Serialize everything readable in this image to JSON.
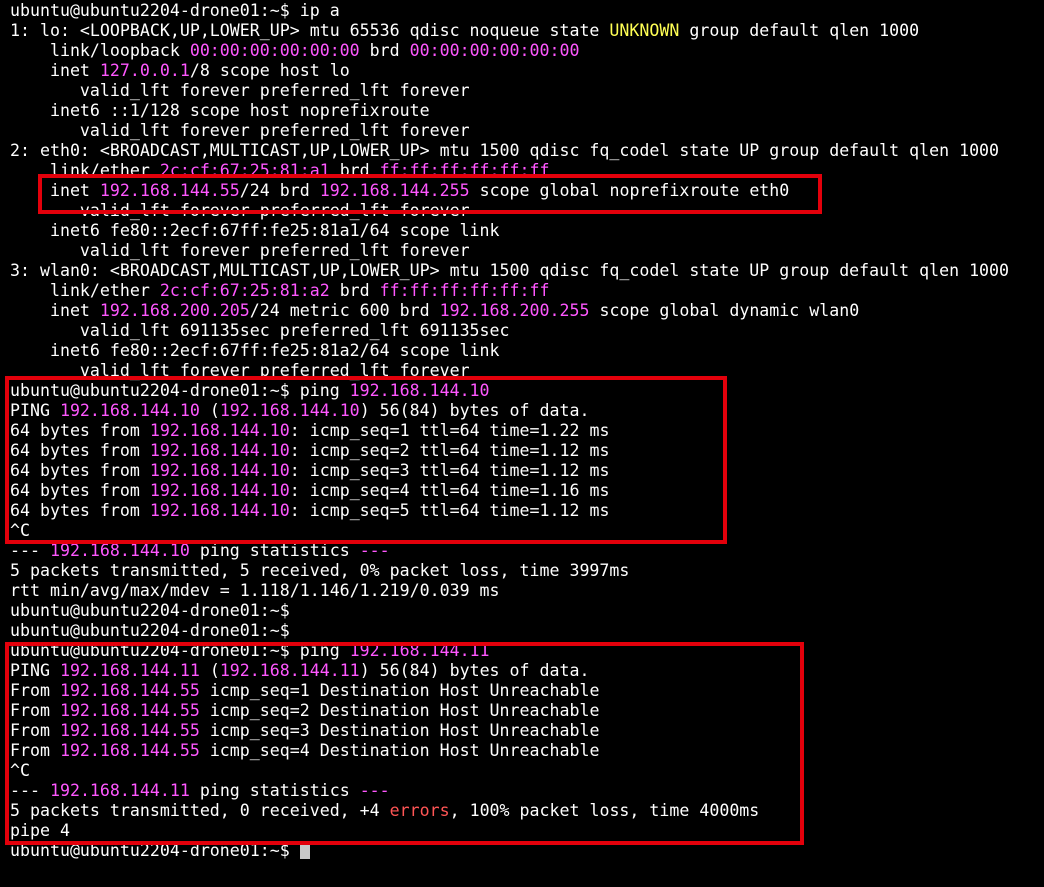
{
  "terminal": {
    "prompt": "ubuntu@ubuntu2204-drone01:~$",
    "lines": [
      [
        {
          "t": "ubuntu@ubuntu2204-drone01:~$ ip a",
          "c": "d"
        }
      ],
      [
        {
          "t": "1: lo: <LOOPBACK,UP,LOWER_UP> mtu 65536 qdisc noqueue state ",
          "c": "d"
        },
        {
          "t": "UNKNOWN",
          "c": "y"
        },
        {
          "t": " group default qlen 1000",
          "c": "d"
        }
      ],
      [
        {
          "t": "    link/loopback ",
          "c": "d"
        },
        {
          "t": "00:00:00:00:00:00",
          "c": "p"
        },
        {
          "t": " brd ",
          "c": "d"
        },
        {
          "t": "00:00:00:00:00:00",
          "c": "p"
        }
      ],
      [
        {
          "t": "    inet ",
          "c": "d"
        },
        {
          "t": "127.0.0.1",
          "c": "p"
        },
        {
          "t": "/8 scope host lo",
          "c": "d"
        }
      ],
      [
        {
          "t": "       valid_lft forever preferred_lft forever",
          "c": "d"
        }
      ],
      [
        {
          "t": "    inet6 ::1/128 scope host noprefixroute",
          "c": "d"
        }
      ],
      [
        {
          "t": "       valid_lft forever preferred_lft forever",
          "c": "d"
        }
      ],
      [
        {
          "t": "2: eth0: <BROADCAST,MULTICAST,UP,LOWER_UP> mtu 1500 qdisc fq_codel state UP group default qlen 1000",
          "c": "d"
        }
      ],
      [
        {
          "t": "    link/ether ",
          "c": "d"
        },
        {
          "t": "2c:cf:67:25:81:a1",
          "c": "p"
        },
        {
          "t": " brd ",
          "c": "d"
        },
        {
          "t": "ff:ff:ff:ff:ff:ff",
          "c": "p"
        }
      ],
      [
        {
          "t": "    inet ",
          "c": "d"
        },
        {
          "t": "192.168.144.55",
          "c": "p"
        },
        {
          "t": "/24 brd ",
          "c": "d"
        },
        {
          "t": "192.168.144.255",
          "c": "p"
        },
        {
          "t": " scope global noprefixroute eth0",
          "c": "d"
        }
      ],
      [
        {
          "t": "       valid_lft forever preferred_lft forever",
          "c": "d"
        }
      ],
      [
        {
          "t": "    inet6 fe80::2ecf:67ff:fe25:81a1/64 scope link",
          "c": "d"
        }
      ],
      [
        {
          "t": "       valid_lft forever preferred_lft forever",
          "c": "d"
        }
      ],
      [
        {
          "t": "3: wlan0: <BROADCAST,MULTICAST,UP,LOWER_UP> mtu 1500 qdisc fq_codel state UP group default qlen 1000",
          "c": "d"
        }
      ],
      [
        {
          "t": "    link/ether ",
          "c": "d"
        },
        {
          "t": "2c:cf:67:25:81:a2",
          "c": "p"
        },
        {
          "t": " brd ",
          "c": "d"
        },
        {
          "t": "ff:ff:ff:ff:ff:ff",
          "c": "p"
        }
      ],
      [
        {
          "t": "    inet ",
          "c": "d"
        },
        {
          "t": "192.168.200.205",
          "c": "p"
        },
        {
          "t": "/24 metric 600 brd ",
          "c": "d"
        },
        {
          "t": "192.168.200.255",
          "c": "p"
        },
        {
          "t": " scope global dynamic wlan0",
          "c": "d"
        }
      ],
      [
        {
          "t": "       valid_lft 691135sec preferred_lft 691135sec",
          "c": "d"
        }
      ],
      [
        {
          "t": "    inet6 fe80::2ecf:67ff:fe25:81a2/64 scope link",
          "c": "d"
        }
      ],
      [
        {
          "t": "       valid_lft forever preferred_lft forever",
          "c": "d"
        }
      ],
      [
        {
          "t": "ubuntu@ubuntu2204-drone01:~$ ping ",
          "c": "d"
        },
        {
          "t": "192.168.144.10",
          "c": "p"
        }
      ],
      [
        {
          "t": "PING ",
          "c": "d"
        },
        {
          "t": "192.168.144.10",
          "c": "p"
        },
        {
          "t": " (",
          "c": "d"
        },
        {
          "t": "192.168.144.10",
          "c": "p"
        },
        {
          "t": ") 56(84) bytes of data.",
          "c": "d"
        }
      ],
      [
        {
          "t": "64 bytes from ",
          "c": "d"
        },
        {
          "t": "192.168.144.10",
          "c": "p"
        },
        {
          "t": ": icmp_seq=1 ttl=64 time=1.22 ms",
          "c": "d"
        }
      ],
      [
        {
          "t": "64 bytes from ",
          "c": "d"
        },
        {
          "t": "192.168.144.10",
          "c": "p"
        },
        {
          "t": ": icmp_seq=2 ttl=64 time=1.12 ms",
          "c": "d"
        }
      ],
      [
        {
          "t": "64 bytes from ",
          "c": "d"
        },
        {
          "t": "192.168.144.10",
          "c": "p"
        },
        {
          "t": ": icmp_seq=3 ttl=64 time=1.12 ms",
          "c": "d"
        }
      ],
      [
        {
          "t": "64 bytes from ",
          "c": "d"
        },
        {
          "t": "192.168.144.10",
          "c": "p"
        },
        {
          "t": ": icmp_seq=4 ttl=64 time=1.16 ms",
          "c": "d"
        }
      ],
      [
        {
          "t": "64 bytes from ",
          "c": "d"
        },
        {
          "t": "192.168.144.10",
          "c": "p"
        },
        {
          "t": ": icmp_seq=5 ttl=64 time=1.12 ms",
          "c": "d"
        }
      ],
      [
        {
          "t": "^C",
          "c": "d"
        }
      ],
      [
        {
          "t": "--- ",
          "c": "d"
        },
        {
          "t": "192.168.144.10",
          "c": "p"
        },
        {
          "t": " ping statistics ",
          "c": "d"
        },
        {
          "t": "---",
          "c": "p"
        }
      ],
      [
        {
          "t": "5 packets transmitted, 5 received, 0% packet loss, time 3997ms",
          "c": "d"
        }
      ],
      [
        {
          "t": "rtt min/avg/max/mdev = 1.118/1.146/1.219/0.039 ms",
          "c": "d"
        }
      ],
      [
        {
          "t": "ubuntu@ubuntu2204-drone01:~$",
          "c": "d"
        }
      ],
      [
        {
          "t": "ubuntu@ubuntu2204-drone01:~$",
          "c": "d"
        }
      ],
      [
        {
          "t": "ubuntu@ubuntu2204-drone01:~$ ping ",
          "c": "d"
        },
        {
          "t": "192.168.144.11",
          "c": "p"
        }
      ],
      [
        {
          "t": "PING ",
          "c": "d"
        },
        {
          "t": "192.168.144.11",
          "c": "p"
        },
        {
          "t": " (",
          "c": "d"
        },
        {
          "t": "192.168.144.11",
          "c": "p"
        },
        {
          "t": ") 56(84) bytes of data.",
          "c": "d"
        }
      ],
      [
        {
          "t": "From ",
          "c": "d"
        },
        {
          "t": "192.168.144.55",
          "c": "p"
        },
        {
          "t": " icmp_seq=1 Destination Host Unreachable",
          "c": "d"
        }
      ],
      [
        {
          "t": "From ",
          "c": "d"
        },
        {
          "t": "192.168.144.55",
          "c": "p"
        },
        {
          "t": " icmp_seq=2 Destination Host Unreachable",
          "c": "d"
        }
      ],
      [
        {
          "t": "From ",
          "c": "d"
        },
        {
          "t": "192.168.144.55",
          "c": "p"
        },
        {
          "t": " icmp_seq=3 Destination Host Unreachable",
          "c": "d"
        }
      ],
      [
        {
          "t": "From ",
          "c": "d"
        },
        {
          "t": "192.168.144.55",
          "c": "p"
        },
        {
          "t": " icmp_seq=4 Destination Host Unreachable",
          "c": "d"
        }
      ],
      [
        {
          "t": "^C",
          "c": "d"
        }
      ],
      [
        {
          "t": "--- ",
          "c": "d"
        },
        {
          "t": "192.168.144.11",
          "c": "p"
        },
        {
          "t": " ping statistics ",
          "c": "d"
        },
        {
          "t": "---",
          "c": "p"
        }
      ],
      [
        {
          "t": "5 packets transmitted, 0 received, +4 ",
          "c": "d"
        },
        {
          "t": "errors",
          "c": "r"
        },
        {
          "t": ", 100% packet loss, time 4000ms",
          "c": "d"
        }
      ],
      [
        {
          "t": "pipe 4",
          "c": "d"
        }
      ]
    ]
  },
  "colors": {
    "background": "#000000",
    "text": "#ffffff",
    "address_magenta": "#ff57ff",
    "state_yellow": "#ffff54",
    "error_red": "#ff5555",
    "annotation_box_red": "#e3000b"
  },
  "icons": {
    "cursor": "block-cursor"
  }
}
